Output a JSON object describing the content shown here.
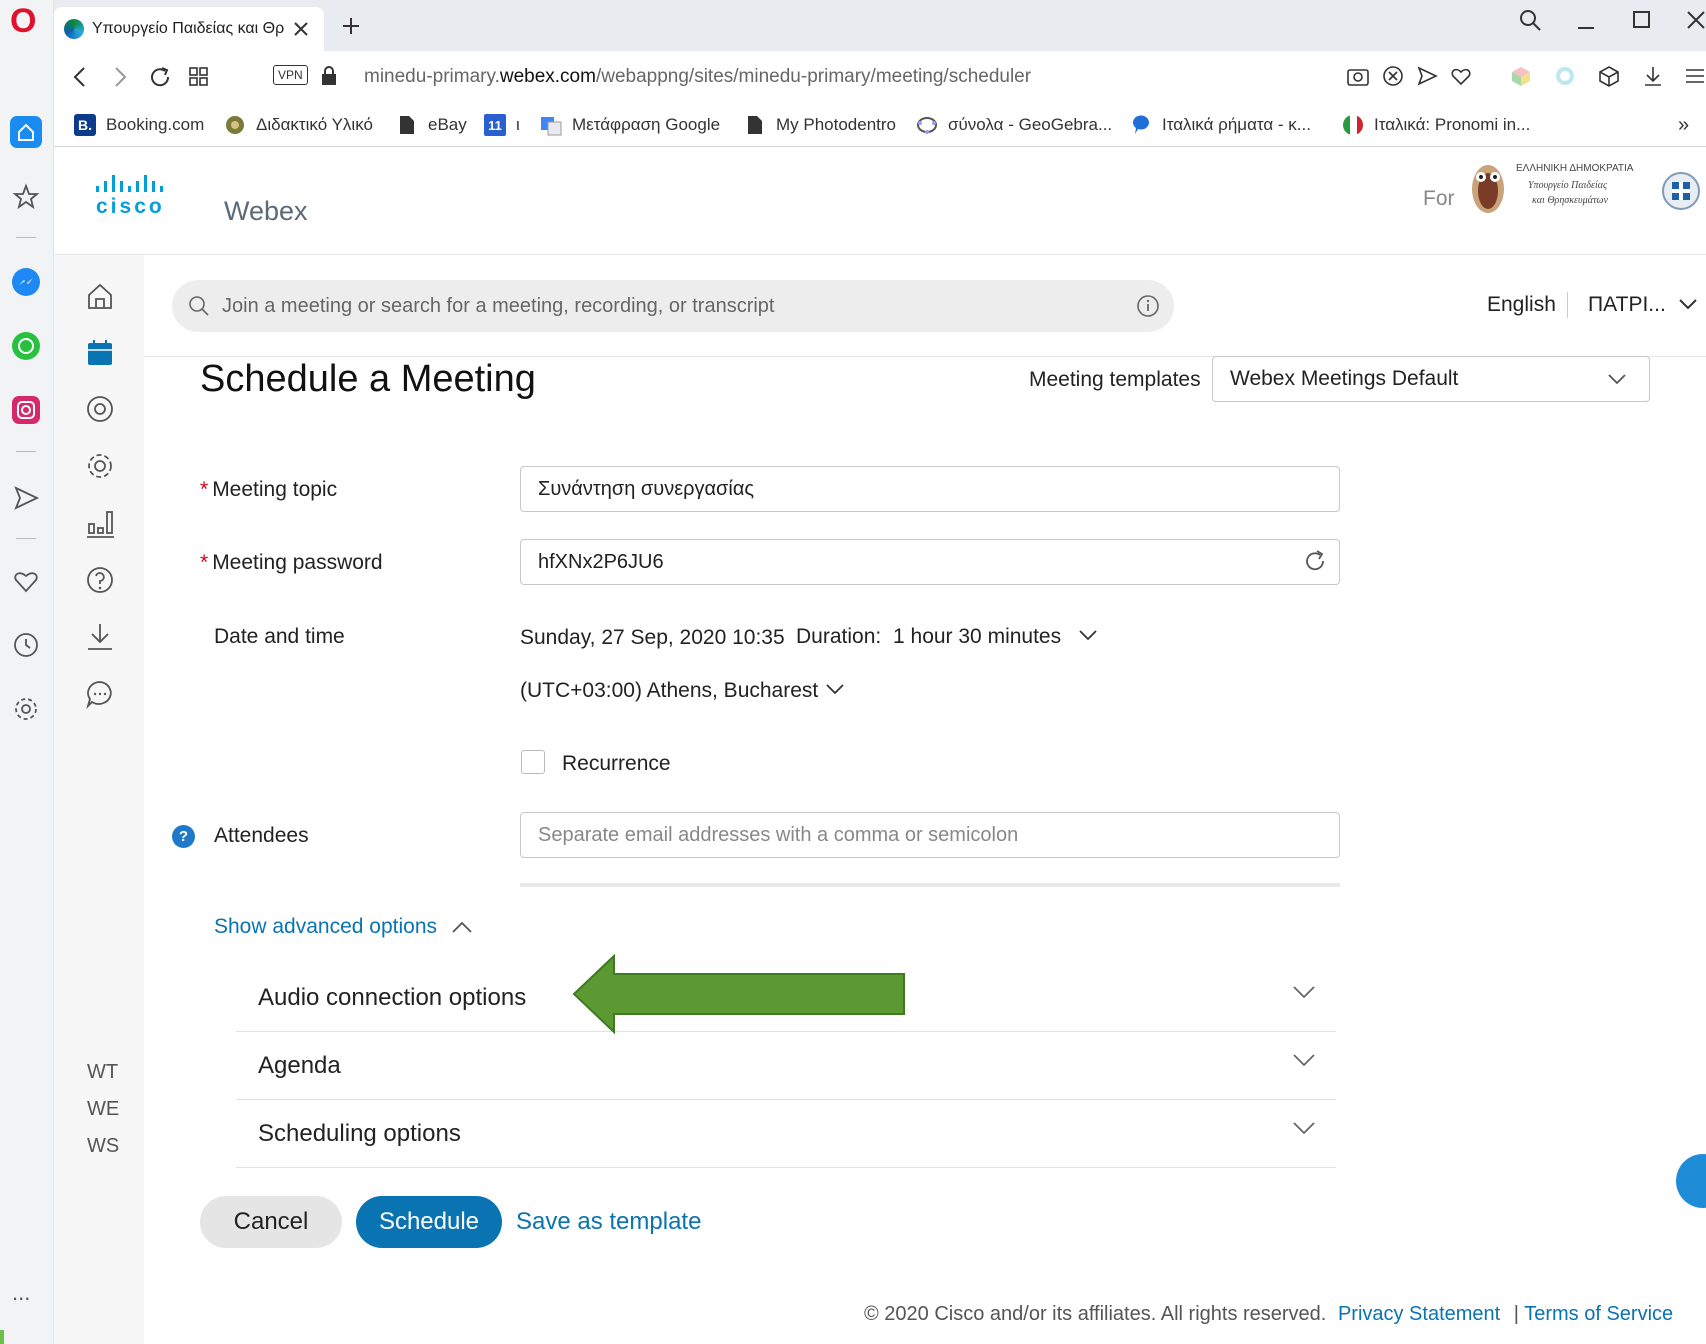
{
  "browser": {
    "tab_title": "Υπουργείο Παιδείας και Θρ",
    "url_prefix": "minedu-primary.",
    "url_domain": "webex.com",
    "url_path": "/webappng/sites/minedu-primary/meeting/scheduler",
    "vpn_label": "VPN",
    "bookmarks": [
      {
        "label": "Booking.com",
        "icon": "booking-icon"
      },
      {
        "label": "Διδακτικό Υλικό",
        "icon": "seal-icon"
      },
      {
        "label": "eBay",
        "icon": "page-icon"
      },
      {
        "label": "ι",
        "icon": "calendar-icon"
      },
      {
        "label": "Μετάφραση Google",
        "icon": "translate-icon"
      },
      {
        "label": "My Photodentro",
        "icon": "page-icon"
      },
      {
        "label": "σύνολα - GeoGebra...",
        "icon": "geogebra-icon"
      },
      {
        "label": "Ιταλικά ρήματα - κ...",
        "icon": "speech-icon"
      },
      {
        "label": "Ιταλικά: Pronomi in...",
        "icon": "italy-flag-icon"
      }
    ],
    "bookmark_calendar_number": "11",
    "more_label": "»",
    "sidebar_more": "...",
    "opera_logo": "O"
  },
  "header": {
    "brand_top": "cisco",
    "brand_name": "Webex",
    "for_label": "For",
    "ministry_line1": "ΕΛΛΗΝΙΚΗ ΔΗΜΟΚΡΑΤΙΑ",
    "ministry_line2": "Υπουργείο Παιδείας",
    "ministry_line3": "και Θρησκευμάτων"
  },
  "search": {
    "placeholder": "Join a meeting or search for a meeting, recording, or transcript"
  },
  "user_menu": {
    "language": "English",
    "user": "ΠΑΤΡΙ..."
  },
  "page": {
    "title": "Schedule a Meeting",
    "templates_label": "Meeting templates",
    "template_value": "Webex Meetings Default"
  },
  "form": {
    "required_mark": "*",
    "topic_label": "Meeting topic",
    "topic_value": "Συνάντηση συνεργασίας",
    "password_label": "Meeting password",
    "password_value": "hfXNx2P6JU6",
    "datetime_label": "Date and time",
    "date_value": "Sunday, 27 Sep, 2020 10:35",
    "duration_label": "Duration:",
    "duration_value": "1 hour 30 minutes",
    "timezone_value": "(UTC+03:00) Athens, Bucharest",
    "recurrence_label": "Recurrence",
    "attendees_label": "Attendees",
    "attendees_help": "?",
    "attendees_placeholder": "Separate email addresses with a comma or semicolon"
  },
  "advanced": {
    "toggle_label": "Show advanced options",
    "sections": [
      "Audio connection options",
      "Agenda",
      "Scheduling options"
    ]
  },
  "actions": {
    "cancel": "Cancel",
    "schedule": "Schedule",
    "save_template": "Save as template"
  },
  "nav_bottom": [
    "WT",
    "WE",
    "WS"
  ],
  "footer": {
    "copyright": "© 2020 Cisco and/or its affiliates. All rights reserved.",
    "privacy": "Privacy Statement",
    "separator": "|",
    "terms": "Terms of Service"
  },
  "colors": {
    "accent": "#0a73b1",
    "arrow": "#5b9a32",
    "required": "#d0021b"
  }
}
